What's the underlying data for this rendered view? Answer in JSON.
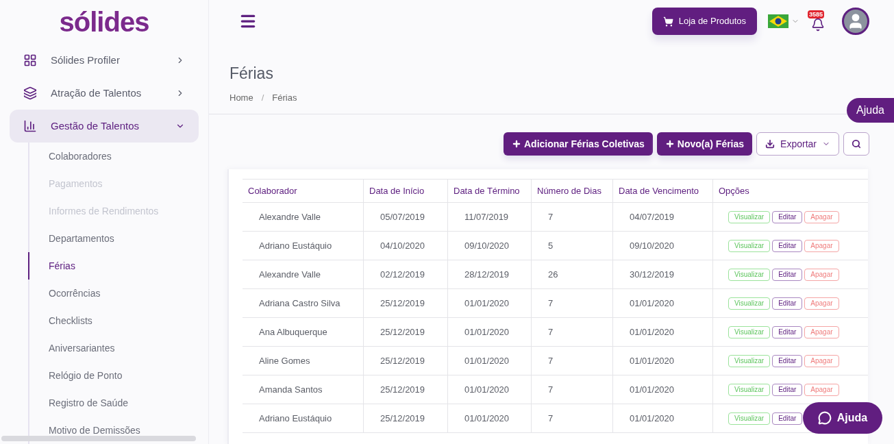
{
  "logo": "sólides",
  "nav": [
    {
      "label": "Sólides Profiler",
      "expanded": false,
      "selected": false
    },
    {
      "label": "Atração de Talentos",
      "expanded": false,
      "selected": false
    },
    {
      "label": "Gestão de Talentos",
      "expanded": true,
      "selected": true,
      "children": [
        {
          "label": "Colaboradores",
          "disabled": false,
          "selected": false
        },
        {
          "label": "Pagamentos",
          "disabled": true,
          "selected": false
        },
        {
          "label": "Informes de Rendimentos",
          "disabled": true,
          "selected": false
        },
        {
          "label": "Departamentos",
          "disabled": false,
          "selected": false
        },
        {
          "label": "Férias",
          "disabled": false,
          "selected": true
        },
        {
          "label": "Ocorrências",
          "disabled": false,
          "selected": false
        },
        {
          "label": "Checklists",
          "disabled": false,
          "selected": false
        },
        {
          "label": "Aniversariantes",
          "disabled": false,
          "selected": false
        },
        {
          "label": "Relógio de Ponto",
          "disabled": false,
          "selected": false
        },
        {
          "label": "Registro de Saúde",
          "disabled": false,
          "selected": false
        },
        {
          "label": "Motivo de Demissões",
          "disabled": false,
          "selected": false
        }
      ]
    }
  ],
  "header": {
    "store_button": "Loja de Produtos",
    "notifications": "3585"
  },
  "page": {
    "title": "Férias",
    "breadcrumb": [
      "Home",
      "Férias"
    ],
    "breadcrumb_separator": "/"
  },
  "help_tab": "Ajuda",
  "toolbar": {
    "buttons": [
      {
        "label": "Adicionar Férias Coletivas",
        "kind": "primary"
      },
      {
        "label": "Novo(a) Férias",
        "kind": "primary"
      },
      {
        "label": "Exportar",
        "kind": "dropdown"
      },
      {
        "kind": "search"
      }
    ]
  },
  "table": {
    "columns": [
      "Colaborador",
      "Data de Início",
      "Data de Término",
      "Número de Dias",
      "Data de Vencimento",
      "Opções"
    ],
    "rows": [
      {
        "cells": [
          "Alexandre Valle",
          "05/07/2019",
          "11/07/2019",
          "7",
          "04/07/2019"
        ],
        "actions": [
          {
            "label": "Visualizar",
            "kind": "view"
          },
          {
            "label": "Editar",
            "kind": "edit"
          },
          {
            "label": "Apagar",
            "kind": "delete"
          }
        ]
      },
      {
        "cells": [
          "Adriano Eustáquio",
          "04/10/2020",
          "09/10/2020",
          "5",
          "09/10/2020"
        ],
        "actions": [
          {
            "label": "Visualizar",
            "kind": "view"
          },
          {
            "label": "Editar",
            "kind": "edit"
          },
          {
            "label": "Apagar",
            "kind": "delete"
          }
        ]
      },
      {
        "cells": [
          "Alexandre Valle",
          "02/12/2019",
          "28/12/2019",
          "26",
          "30/12/2019"
        ],
        "actions": [
          {
            "label": "Visualizar",
            "kind": "view"
          },
          {
            "label": "Editar",
            "kind": "edit"
          },
          {
            "label": "Apagar",
            "kind": "delete"
          }
        ]
      },
      {
        "cells": [
          "Adriana Castro Silva",
          "25/12/2019",
          "01/01/2020",
          "7",
          "01/01/2020"
        ],
        "actions": [
          {
            "label": "Visualizar",
            "kind": "view"
          },
          {
            "label": "Editar",
            "kind": "edit"
          },
          {
            "label": "Apagar",
            "kind": "delete"
          }
        ]
      },
      {
        "cells": [
          "Ana Albuquerque",
          "25/12/2019",
          "01/01/2020",
          "7",
          "01/01/2020"
        ],
        "actions": [
          {
            "label": "Visualizar",
            "kind": "view"
          },
          {
            "label": "Editar",
            "kind": "edit"
          },
          {
            "label": "Apagar",
            "kind": "delete"
          }
        ]
      },
      {
        "cells": [
          "Aline Gomes",
          "25/12/2019",
          "01/01/2020",
          "7",
          "01/01/2020"
        ],
        "actions": [
          {
            "label": "Visualizar",
            "kind": "view"
          },
          {
            "label": "Editar",
            "kind": "edit"
          },
          {
            "label": "Apagar",
            "kind": "delete"
          }
        ]
      },
      {
        "cells": [
          "Amanda Santos",
          "25/12/2019",
          "01/01/2020",
          "7",
          "01/01/2020"
        ],
        "actions": [
          {
            "label": "Visualizar",
            "kind": "view"
          },
          {
            "label": "Editar",
            "kind": "edit"
          },
          {
            "label": "Apagar",
            "kind": "delete"
          }
        ]
      },
      {
        "cells": [
          "Adriano Eustáquio",
          "25/12/2019",
          "01/01/2020",
          "7",
          "01/01/2020"
        ],
        "actions": [
          {
            "label": "Visualizar",
            "kind": "view"
          },
          {
            "label": "Editar",
            "kind": "edit"
          }
        ]
      }
    ]
  },
  "chat_button": "Ajuda"
}
